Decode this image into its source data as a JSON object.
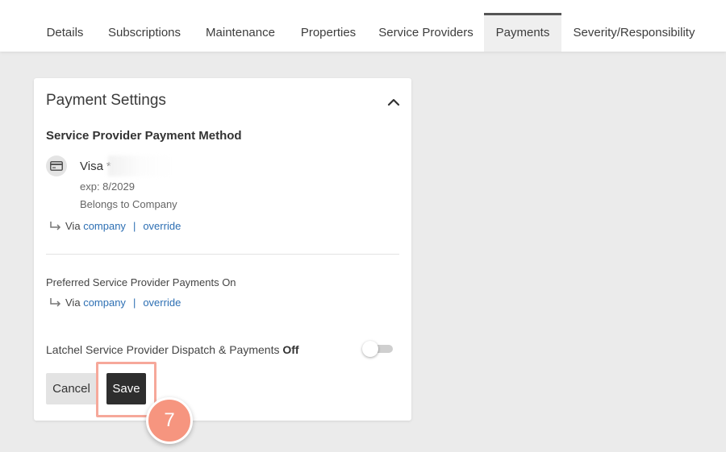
{
  "tabs": [
    {
      "label": "Details"
    },
    {
      "label": "Subscriptions"
    },
    {
      "label": "Maintenance"
    },
    {
      "label": "Properties"
    },
    {
      "label": "Service Providers"
    },
    {
      "label": "Payments",
      "active": true
    },
    {
      "label": "Severity/Responsibility"
    }
  ],
  "card": {
    "title": "Payment Settings",
    "collapse_icon": "chevron-up-icon",
    "payment_method": {
      "heading": "Service Provider Payment Method",
      "icon": "credit-card-icon",
      "brand": "Visa *",
      "expiry": "exp: 8/2029",
      "owner": "Belongs to Company",
      "via_label": "Via",
      "via_link": "company",
      "separator": "|",
      "override_link": "override"
    },
    "preferred_payments": {
      "label": "Preferred Service Provider Payments On",
      "via_label": "Via",
      "via_link": "company",
      "separator": "|",
      "override_link": "override"
    },
    "latchel": {
      "label": "Latchel Service Provider Dispatch & Payments",
      "state": "Off",
      "enabled": false
    },
    "buttons": {
      "cancel": "Cancel",
      "save": "Save"
    }
  },
  "annotation": {
    "step_number": "7",
    "color": "#f6957f"
  },
  "colors": {
    "link": "#2d6fb3",
    "save_button": "#2e2e2e",
    "active_tab_border": "#555555"
  }
}
